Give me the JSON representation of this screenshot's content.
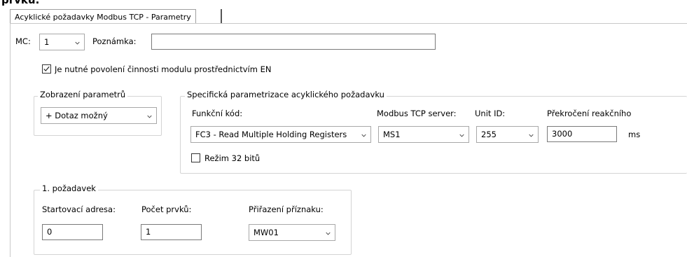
{
  "header": {
    "cut_text": "prvků."
  },
  "tab": {
    "label": "Acyklické požadavky Modbus TCP - Parametry"
  },
  "top": {
    "mc_label": "MC:",
    "mc_value": "1",
    "note_label": "Poznámka:",
    "note_value": ""
  },
  "enable": {
    "label": "Je nutné povolení činnosti modulu prostřednictvím EN",
    "checked": true
  },
  "display": {
    "legend": "Zobrazení parametrů",
    "value": "+ Dotaz možný"
  },
  "specific": {
    "legend": "Specifická parametrizace acyklického požadavku",
    "function_label": "Funkční kód:",
    "function_value": "FC3 - Read Multiple Holding Registers",
    "server_label": "Modbus TCP server:",
    "server_value": "MS1",
    "unit_label": "Unit ID:",
    "unit_value": "255",
    "timeout_label": "Překročení reakčního",
    "timeout_value": "3000",
    "timeout_unit": "ms",
    "mode_label": "Režim 32 bitů",
    "mode_checked": false
  },
  "request": {
    "legend": "1. požadavek",
    "start_label": "Startovací adresa:",
    "start_value": "0",
    "count_label": "Počet prvků:",
    "count_value": "1",
    "flag_label": "Přiřazení příznaku:",
    "flag_value": "MW01"
  },
  "icons": {
    "dropdown": "chevron-down-icon",
    "check": "checkmark-icon"
  }
}
